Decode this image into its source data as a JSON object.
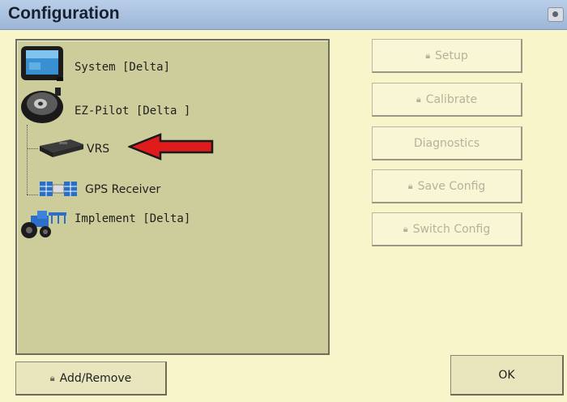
{
  "window": {
    "title": "Configuration",
    "camera_icon": "camera-icon"
  },
  "tree": {
    "items": [
      {
        "label": "System [Delta]",
        "icon": "display-console-icon"
      },
      {
        "label": "EZ-Pilot [Delta ]",
        "icon": "steering-motor-icon"
      },
      {
        "label": "VRS",
        "icon": "radio-receiver-icon"
      },
      {
        "label": "GPS Receiver",
        "icon": "satellite-icon"
      },
      {
        "label": "Implement [Delta]",
        "icon": "tractor-icon"
      }
    ]
  },
  "annotation": {
    "arrow_color": "#e01b1b"
  },
  "actions": {
    "setup": "Setup",
    "calibrate": "Calibrate",
    "diagnostics": "Diagnostics",
    "save_config": "Save Config",
    "switch_config": "Switch Config"
  },
  "footer": {
    "add_remove": "Add/Remove",
    "ok": "OK"
  }
}
